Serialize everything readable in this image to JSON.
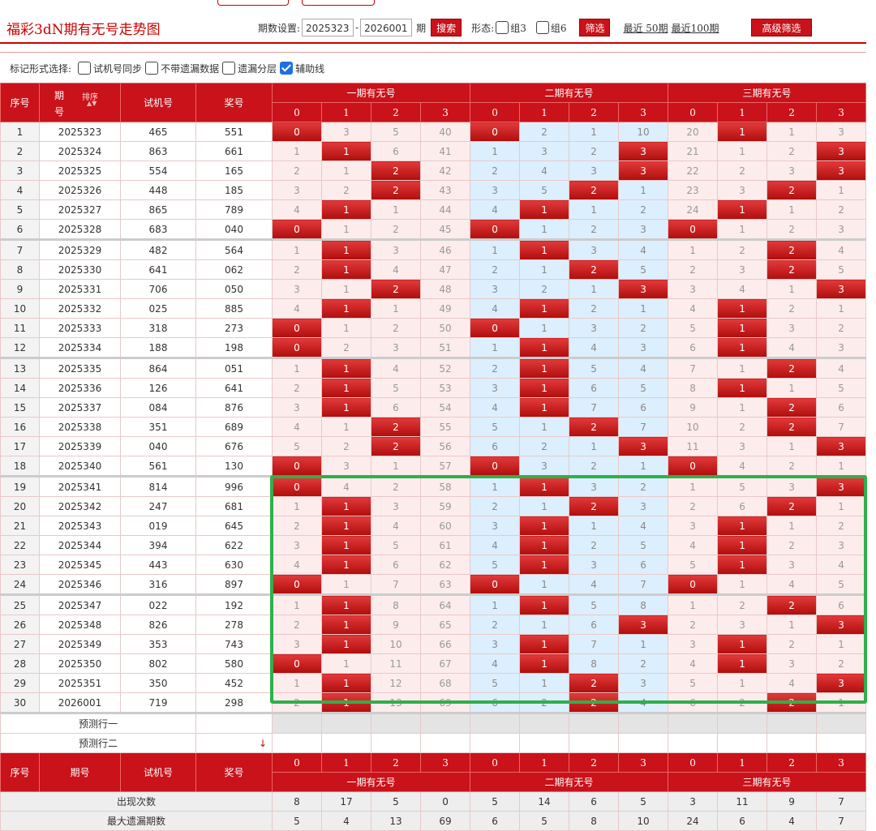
{
  "header": {
    "title": "福彩3dN期有无号走势图",
    "period_label": "期数设置:",
    "period_from": "2025323",
    "period_sep": "-",
    "period_to": "2026001",
    "period_unit": "期",
    "search_label": "搜索",
    "shape_label": "形态:",
    "zu3_label": "组3",
    "zu6_label": "组6",
    "filter_label": "筛选",
    "recent50": "最近 50期",
    "recent100": "最近100期",
    "advanced": "高级筛选"
  },
  "marks": {
    "label": "标记形式选择:",
    "options": [
      {
        "label": "试机号同步",
        "checked": false
      },
      {
        "label": "不带遗漏数据",
        "checked": false
      },
      {
        "label": "遗漏分层",
        "checked": false
      },
      {
        "label": "辅助线",
        "checked": true
      }
    ]
  },
  "table": {
    "col_seq": "序号",
    "col_issue": "期号",
    "col_issue_a": "期",
    "col_issue_b": "号",
    "sort_label": "排序",
    "col_trial": "试机号",
    "col_prize": "奖号",
    "group1": "一期有无号",
    "group2": "二期有无号",
    "group3": "三期有无号",
    "sub_labels": [
      "0",
      "1",
      "2",
      "3",
      "0",
      "1",
      "2",
      "3",
      "0",
      "1",
      "2",
      "3"
    ],
    "rows": [
      {
        "seq": "1",
        "issue": "2025323",
        "trial": "465",
        "prize": "551",
        "cells": [
          "0",
          "3",
          "5",
          "40",
          "0",
          "2",
          "1",
          "10",
          "20",
          "1",
          "1",
          "3"
        ],
        "hits": [
          0,
          4,
          9
        ]
      },
      {
        "seq": "2",
        "issue": "2025324",
        "trial": "863",
        "prize": "661",
        "cells": [
          "1",
          "1",
          "6",
          "41",
          "1",
          "3",
          "2",
          "3",
          "21",
          "1",
          "2",
          "3"
        ],
        "hits": [
          1,
          7,
          11
        ]
      },
      {
        "seq": "3",
        "issue": "2025325",
        "trial": "554",
        "prize": "165",
        "cells": [
          "2",
          "1",
          "2",
          "42",
          "2",
          "4",
          "3",
          "3",
          "22",
          "2",
          "3",
          "3"
        ],
        "hits": [
          2,
          7,
          11
        ]
      },
      {
        "seq": "4",
        "issue": "2025326",
        "trial": "448",
        "prize": "185",
        "cells": [
          "3",
          "2",
          "2",
          "43",
          "3",
          "5",
          "2",
          "1",
          "23",
          "3",
          "2",
          "1"
        ],
        "hits": [
          2,
          6,
          10
        ]
      },
      {
        "seq": "5",
        "issue": "2025327",
        "trial": "865",
        "prize": "789",
        "cells": [
          "4",
          "1",
          "1",
          "44",
          "4",
          "1",
          "1",
          "2",
          "24",
          "1",
          "1",
          "2"
        ],
        "hits": [
          1,
          5,
          9
        ]
      },
      {
        "seq": "6",
        "issue": "2025328",
        "trial": "683",
        "prize": "040",
        "cells": [
          "0",
          "1",
          "2",
          "45",
          "0",
          "1",
          "2",
          "3",
          "0",
          "1",
          "2",
          "3"
        ],
        "hits": [
          0,
          4,
          8
        ]
      },
      {
        "seq": "7",
        "issue": "2025329",
        "trial": "482",
        "prize": "564",
        "cells": [
          "1",
          "1",
          "3",
          "46",
          "1",
          "1",
          "3",
          "4",
          "1",
          "2",
          "2",
          "4"
        ],
        "hits": [
          1,
          5,
          10
        ]
      },
      {
        "seq": "8",
        "issue": "2025330",
        "trial": "641",
        "prize": "062",
        "cells": [
          "2",
          "1",
          "4",
          "47",
          "2",
          "1",
          "2",
          "5",
          "2",
          "3",
          "2",
          "5"
        ],
        "hits": [
          1,
          6,
          10
        ]
      },
      {
        "seq": "9",
        "issue": "2025331",
        "trial": "706",
        "prize": "050",
        "cells": [
          "3",
          "1",
          "2",
          "48",
          "3",
          "2",
          "1",
          "3",
          "3",
          "4",
          "1",
          "3"
        ],
        "hits": [
          2,
          7,
          11
        ]
      },
      {
        "seq": "10",
        "issue": "2025332",
        "trial": "025",
        "prize": "885",
        "cells": [
          "4",
          "1",
          "1",
          "49",
          "4",
          "1",
          "2",
          "1",
          "4",
          "1",
          "2",
          "1"
        ],
        "hits": [
          1,
          5,
          9
        ]
      },
      {
        "seq": "11",
        "issue": "2025333",
        "trial": "318",
        "prize": "273",
        "cells": [
          "0",
          "1",
          "2",
          "50",
          "0",
          "1",
          "3",
          "2",
          "5",
          "1",
          "3",
          "2"
        ],
        "hits": [
          0,
          4,
          9
        ]
      },
      {
        "seq": "12",
        "issue": "2025334",
        "trial": "188",
        "prize": "198",
        "cells": [
          "0",
          "2",
          "3",
          "51",
          "1",
          "1",
          "4",
          "3",
          "6",
          "1",
          "4",
          "3"
        ],
        "hits": [
          0,
          5,
          9
        ]
      },
      {
        "seq": "13",
        "issue": "2025335",
        "trial": "864",
        "prize": "051",
        "cells": [
          "1",
          "1",
          "4",
          "52",
          "2",
          "1",
          "5",
          "4",
          "7",
          "1",
          "2",
          "4"
        ],
        "hits": [
          1,
          5,
          10
        ]
      },
      {
        "seq": "14",
        "issue": "2025336",
        "trial": "126",
        "prize": "641",
        "cells": [
          "2",
          "1",
          "5",
          "53",
          "3",
          "1",
          "6",
          "5",
          "8",
          "1",
          "1",
          "5"
        ],
        "hits": [
          1,
          5,
          9
        ]
      },
      {
        "seq": "15",
        "issue": "2025337",
        "trial": "084",
        "prize": "876",
        "cells": [
          "3",
          "1",
          "6",
          "54",
          "4",
          "1",
          "7",
          "6",
          "9",
          "1",
          "2",
          "6"
        ],
        "hits": [
          1,
          5,
          10
        ]
      },
      {
        "seq": "16",
        "issue": "2025338",
        "trial": "351",
        "prize": "689",
        "cells": [
          "4",
          "1",
          "2",
          "55",
          "5",
          "1",
          "2",
          "7",
          "10",
          "2",
          "2",
          "7"
        ],
        "hits": [
          2,
          6,
          10
        ]
      },
      {
        "seq": "17",
        "issue": "2025339",
        "trial": "040",
        "prize": "676",
        "cells": [
          "5",
          "2",
          "2",
          "56",
          "6",
          "2",
          "1",
          "3",
          "11",
          "3",
          "1",
          "3"
        ],
        "hits": [
          2,
          7,
          11
        ]
      },
      {
        "seq": "18",
        "issue": "2025340",
        "trial": "561",
        "prize": "130",
        "cells": [
          "0",
          "3",
          "1",
          "57",
          "0",
          "3",
          "2",
          "1",
          "0",
          "4",
          "2",
          "1"
        ],
        "hits": [
          0,
          4,
          8
        ]
      },
      {
        "seq": "19",
        "issue": "2025341",
        "trial": "814",
        "prize": "996",
        "cells": [
          "0",
          "4",
          "2",
          "58",
          "1",
          "1",
          "3",
          "2",
          "1",
          "5",
          "3",
          "3"
        ],
        "hits": [
          0,
          5,
          11
        ]
      },
      {
        "seq": "20",
        "issue": "2025342",
        "trial": "247",
        "prize": "681",
        "cells": [
          "1",
          "1",
          "3",
          "59",
          "2",
          "1",
          "2",
          "3",
          "2",
          "6",
          "2",
          "1"
        ],
        "hits": [
          1,
          6,
          10
        ]
      },
      {
        "seq": "21",
        "issue": "2025343",
        "trial": "019",
        "prize": "645",
        "cells": [
          "2",
          "1",
          "4",
          "60",
          "3",
          "1",
          "1",
          "4",
          "3",
          "1",
          "1",
          "2"
        ],
        "hits": [
          1,
          5,
          9
        ]
      },
      {
        "seq": "22",
        "issue": "2025344",
        "trial": "394",
        "prize": "622",
        "cells": [
          "3",
          "1",
          "5",
          "61",
          "4",
          "1",
          "2",
          "5",
          "4",
          "1",
          "2",
          "3"
        ],
        "hits": [
          1,
          5,
          9
        ]
      },
      {
        "seq": "23",
        "issue": "2025345",
        "trial": "443",
        "prize": "630",
        "cells": [
          "4",
          "1",
          "6",
          "62",
          "5",
          "1",
          "3",
          "6",
          "5",
          "1",
          "3",
          "4"
        ],
        "hits": [
          1,
          5,
          9
        ]
      },
      {
        "seq": "24",
        "issue": "2025346",
        "trial": "316",
        "prize": "897",
        "cells": [
          "0",
          "1",
          "7",
          "63",
          "0",
          "1",
          "4",
          "7",
          "0",
          "1",
          "4",
          "5"
        ],
        "hits": [
          0,
          4,
          8
        ]
      },
      {
        "seq": "25",
        "issue": "2025347",
        "trial": "022",
        "prize": "192",
        "cells": [
          "1",
          "1",
          "8",
          "64",
          "1",
          "1",
          "5",
          "8",
          "1",
          "2",
          "2",
          "6"
        ],
        "hits": [
          1,
          5,
          10
        ]
      },
      {
        "seq": "26",
        "issue": "2025348",
        "trial": "826",
        "prize": "278",
        "cells": [
          "2",
          "1",
          "9",
          "65",
          "2",
          "1",
          "6",
          "3",
          "2",
          "3",
          "1",
          "3"
        ],
        "hits": [
          1,
          7,
          11
        ]
      },
      {
        "seq": "27",
        "issue": "2025349",
        "trial": "353",
        "prize": "743",
        "cells": [
          "3",
          "1",
          "10",
          "66",
          "3",
          "1",
          "7",
          "1",
          "3",
          "1",
          "2",
          "1"
        ],
        "hits": [
          1,
          5,
          9
        ]
      },
      {
        "seq": "28",
        "issue": "2025350",
        "trial": "802",
        "prize": "580",
        "cells": [
          "0",
          "1",
          "11",
          "67",
          "4",
          "1",
          "8",
          "2",
          "4",
          "1",
          "3",
          "2"
        ],
        "hits": [
          0,
          5,
          9
        ]
      },
      {
        "seq": "29",
        "issue": "2025351",
        "trial": "350",
        "prize": "452",
        "cells": [
          "1",
          "1",
          "12",
          "68",
          "5",
          "1",
          "2",
          "3",
          "5",
          "1",
          "4",
          "3"
        ],
        "hits": [
          1,
          6,
          11
        ]
      },
      {
        "seq": "30",
        "issue": "2026001",
        "trial": "719",
        "prize": "298",
        "cells": [
          "2",
          "1",
          "13",
          "69",
          "6",
          "2",
          "2",
          "4",
          "6",
          "2",
          "2",
          "1"
        ],
        "hits": [
          1,
          6,
          10
        ]
      }
    ],
    "predict1": "预测行一",
    "predict2": "预测行二",
    "predict_arrow": "↓",
    "stats": [
      {
        "label": "出现次数",
        "values": [
          "8",
          "17",
          "5",
          "0",
          "5",
          "14",
          "6",
          "5",
          "3",
          "11",
          "9",
          "7"
        ]
      },
      {
        "label": "最大遗漏期数",
        "values": [
          "5",
          "4",
          "13",
          "69",
          "6",
          "5",
          "8",
          "10",
          "24",
          "6",
          "4",
          "7"
        ]
      }
    ]
  },
  "colors": {
    "red": "#c9121a",
    "green_box": "#2eb04a",
    "blue_cell": "#dcefff",
    "pink_cell": "#fdecec"
  }
}
